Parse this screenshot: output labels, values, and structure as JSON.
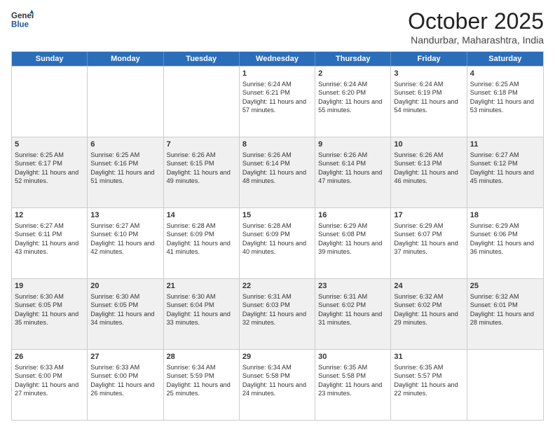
{
  "header": {
    "logo_general": "General",
    "logo_blue": "Blue",
    "month": "October 2025",
    "location": "Nandurbar, Maharashtra, India"
  },
  "days_of_week": [
    "Sunday",
    "Monday",
    "Tuesday",
    "Wednesday",
    "Thursday",
    "Friday",
    "Saturday"
  ],
  "weeks": [
    [
      {
        "day": "",
        "info": ""
      },
      {
        "day": "",
        "info": ""
      },
      {
        "day": "",
        "info": ""
      },
      {
        "day": "1",
        "info": "Sunrise: 6:24 AM\nSunset: 6:21 PM\nDaylight: 11 hours and 57 minutes."
      },
      {
        "day": "2",
        "info": "Sunrise: 6:24 AM\nSunset: 6:20 PM\nDaylight: 11 hours and 55 minutes."
      },
      {
        "day": "3",
        "info": "Sunrise: 6:24 AM\nSunset: 6:19 PM\nDaylight: 11 hours and 54 minutes."
      },
      {
        "day": "4",
        "info": "Sunrise: 6:25 AM\nSunset: 6:18 PM\nDaylight: 11 hours and 53 minutes."
      }
    ],
    [
      {
        "day": "5",
        "info": "Sunrise: 6:25 AM\nSunset: 6:17 PM\nDaylight: 11 hours and 52 minutes."
      },
      {
        "day": "6",
        "info": "Sunrise: 6:25 AM\nSunset: 6:16 PM\nDaylight: 11 hours and 51 minutes."
      },
      {
        "day": "7",
        "info": "Sunrise: 6:26 AM\nSunset: 6:15 PM\nDaylight: 11 hours and 49 minutes."
      },
      {
        "day": "8",
        "info": "Sunrise: 6:26 AM\nSunset: 6:14 PM\nDaylight: 11 hours and 48 minutes."
      },
      {
        "day": "9",
        "info": "Sunrise: 6:26 AM\nSunset: 6:14 PM\nDaylight: 11 hours and 47 minutes."
      },
      {
        "day": "10",
        "info": "Sunrise: 6:26 AM\nSunset: 6:13 PM\nDaylight: 11 hours and 46 minutes."
      },
      {
        "day": "11",
        "info": "Sunrise: 6:27 AM\nSunset: 6:12 PM\nDaylight: 11 hours and 45 minutes."
      }
    ],
    [
      {
        "day": "12",
        "info": "Sunrise: 6:27 AM\nSunset: 6:11 PM\nDaylight: 11 hours and 43 minutes."
      },
      {
        "day": "13",
        "info": "Sunrise: 6:27 AM\nSunset: 6:10 PM\nDaylight: 11 hours and 42 minutes."
      },
      {
        "day": "14",
        "info": "Sunrise: 6:28 AM\nSunset: 6:09 PM\nDaylight: 11 hours and 41 minutes."
      },
      {
        "day": "15",
        "info": "Sunrise: 6:28 AM\nSunset: 6:09 PM\nDaylight: 11 hours and 40 minutes."
      },
      {
        "day": "16",
        "info": "Sunrise: 6:29 AM\nSunset: 6:08 PM\nDaylight: 11 hours and 39 minutes."
      },
      {
        "day": "17",
        "info": "Sunrise: 6:29 AM\nSunset: 6:07 PM\nDaylight: 11 hours and 37 minutes."
      },
      {
        "day": "18",
        "info": "Sunrise: 6:29 AM\nSunset: 6:06 PM\nDaylight: 11 hours and 36 minutes."
      }
    ],
    [
      {
        "day": "19",
        "info": "Sunrise: 6:30 AM\nSunset: 6:05 PM\nDaylight: 11 hours and 35 minutes."
      },
      {
        "day": "20",
        "info": "Sunrise: 6:30 AM\nSunset: 6:05 PM\nDaylight: 11 hours and 34 minutes."
      },
      {
        "day": "21",
        "info": "Sunrise: 6:30 AM\nSunset: 6:04 PM\nDaylight: 11 hours and 33 minutes."
      },
      {
        "day": "22",
        "info": "Sunrise: 6:31 AM\nSunset: 6:03 PM\nDaylight: 11 hours and 32 minutes."
      },
      {
        "day": "23",
        "info": "Sunrise: 6:31 AM\nSunset: 6:02 PM\nDaylight: 11 hours and 31 minutes."
      },
      {
        "day": "24",
        "info": "Sunrise: 6:32 AM\nSunset: 6:02 PM\nDaylight: 11 hours and 29 minutes."
      },
      {
        "day": "25",
        "info": "Sunrise: 6:32 AM\nSunset: 6:01 PM\nDaylight: 11 hours and 28 minutes."
      }
    ],
    [
      {
        "day": "26",
        "info": "Sunrise: 6:33 AM\nSunset: 6:00 PM\nDaylight: 11 hours and 27 minutes."
      },
      {
        "day": "27",
        "info": "Sunrise: 6:33 AM\nSunset: 6:00 PM\nDaylight: 11 hours and 26 minutes."
      },
      {
        "day": "28",
        "info": "Sunrise: 6:34 AM\nSunset: 5:59 PM\nDaylight: 11 hours and 25 minutes."
      },
      {
        "day": "29",
        "info": "Sunrise: 6:34 AM\nSunset: 5:58 PM\nDaylight: 11 hours and 24 minutes."
      },
      {
        "day": "30",
        "info": "Sunrise: 6:35 AM\nSunset: 5:58 PM\nDaylight: 11 hours and 23 minutes."
      },
      {
        "day": "31",
        "info": "Sunrise: 6:35 AM\nSunset: 5:57 PM\nDaylight: 11 hours and 22 minutes."
      },
      {
        "day": "",
        "info": ""
      }
    ]
  ]
}
